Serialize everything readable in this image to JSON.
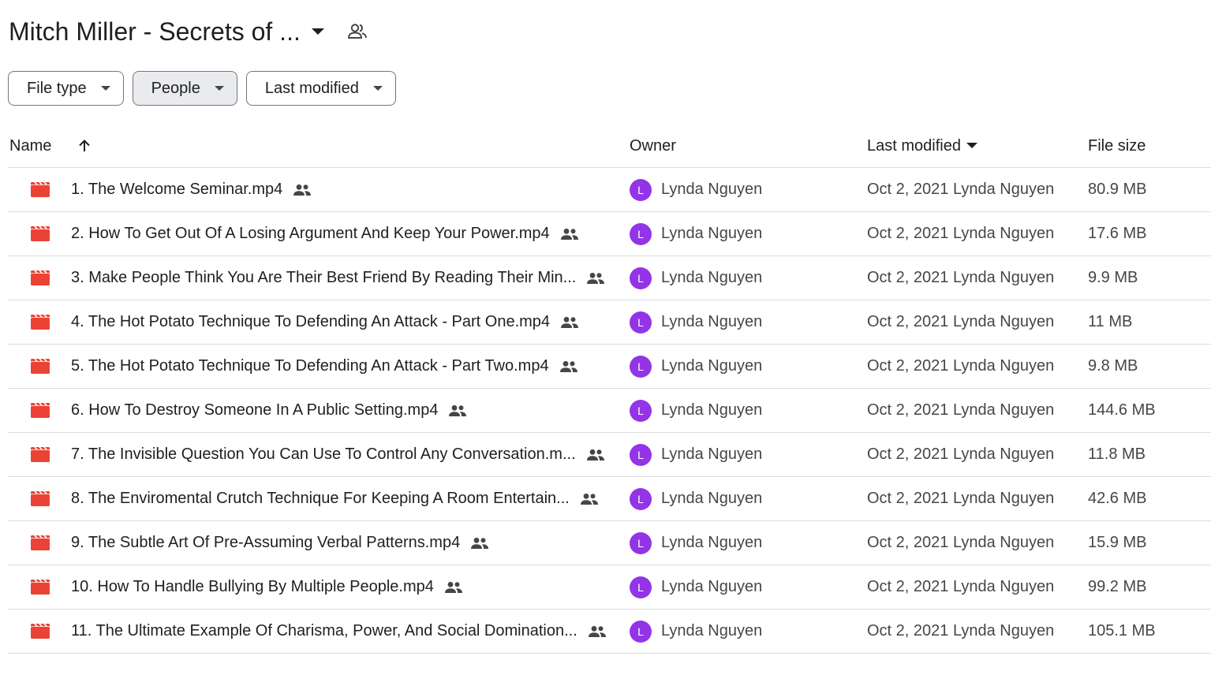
{
  "header": {
    "title": "Mitch Miller - Secrets of ...",
    "caret_icon": "arrow-drop-down-icon",
    "shared_icon": "people-outline-icon"
  },
  "filters": [
    {
      "label": "File type",
      "active": false
    },
    {
      "label": "People",
      "active": true
    },
    {
      "label": "Last modified",
      "active": false
    }
  ],
  "table": {
    "columns": {
      "name": "Name",
      "owner": "Owner",
      "last_modified": "Last modified",
      "file_size": "File size"
    },
    "rows": [
      {
        "name": "1. The Welcome Seminar.mp4",
        "owner": "Lynda Nguyen",
        "owner_initial": "L",
        "modified": "Oct 2, 2021 Lynda Nguyen",
        "size": "80.9 MB"
      },
      {
        "name": "2. How To Get Out Of A Losing Argument And Keep Your Power.mp4",
        "owner": "Lynda Nguyen",
        "owner_initial": "L",
        "modified": "Oct 2, 2021 Lynda Nguyen",
        "size": "17.6 MB"
      },
      {
        "name": "3. Make People Think You Are Their Best Friend By Reading Their Min...",
        "owner": "Lynda Nguyen",
        "owner_initial": "L",
        "modified": "Oct 2, 2021 Lynda Nguyen",
        "size": "9.9 MB"
      },
      {
        "name": "4. The Hot Potato Technique To Defending An Attack - Part One.mp4",
        "owner": "Lynda Nguyen",
        "owner_initial": "L",
        "modified": "Oct 2, 2021 Lynda Nguyen",
        "size": "11 MB"
      },
      {
        "name": "5. The Hot Potato Technique To Defending An Attack - Part Two.mp4",
        "owner": "Lynda Nguyen",
        "owner_initial": "L",
        "modified": "Oct 2, 2021 Lynda Nguyen",
        "size": "9.8 MB"
      },
      {
        "name": "6. How To Destroy Someone In A Public Setting.mp4",
        "owner": "Lynda Nguyen",
        "owner_initial": "L",
        "modified": "Oct 2, 2021 Lynda Nguyen",
        "size": "144.6 MB"
      },
      {
        "name": "7. The Invisible Question You Can Use To Control Any Conversation.m...",
        "owner": "Lynda Nguyen",
        "owner_initial": "L",
        "modified": "Oct 2, 2021 Lynda Nguyen",
        "size": "11.8 MB"
      },
      {
        "name": "8. The Enviromental Crutch Technique For Keeping A Room Entertain...",
        "owner": "Lynda Nguyen",
        "owner_initial": "L",
        "modified": "Oct 2, 2021 Lynda Nguyen",
        "size": "42.6 MB"
      },
      {
        "name": "9. The Subtle Art Of Pre-Assuming Verbal Patterns.mp4",
        "owner": "Lynda Nguyen",
        "owner_initial": "L",
        "modified": "Oct 2, 2021 Lynda Nguyen",
        "size": "15.9 MB"
      },
      {
        "name": "10. How To Handle Bullying By Multiple People.mp4",
        "owner": "Lynda Nguyen",
        "owner_initial": "L",
        "modified": "Oct 2, 2021 Lynda Nguyen",
        "size": "99.2 MB"
      },
      {
        "name": "11. The Ultimate Example Of Charisma, Power, And Social Domination...",
        "owner": "Lynda Nguyen",
        "owner_initial": "L",
        "modified": "Oct 2, 2021 Lynda Nguyen",
        "size": "105.1 MB"
      }
    ]
  },
  "colors": {
    "video_icon": "#ea4335",
    "avatar": "#9334e6",
    "border": "#dadce0",
    "chip_active_bg": "#e9ebee"
  }
}
